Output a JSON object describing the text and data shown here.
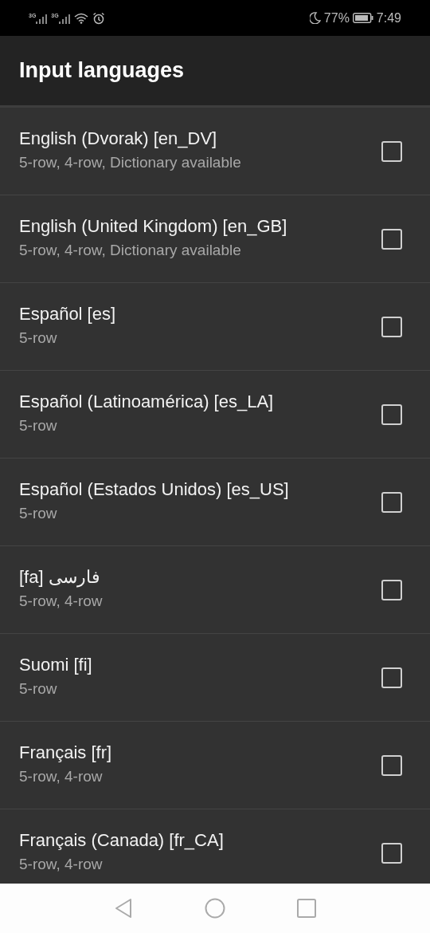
{
  "status_bar": {
    "network_labels": [
      "3G",
      "3G"
    ],
    "battery_percent": "77%",
    "time": "7:49"
  },
  "header": {
    "title": "Input languages"
  },
  "languages": [
    {
      "name": "English (Dvorak) [en_DV]",
      "layouts": "5-row, 4-row, Dictionary available",
      "checked": false
    },
    {
      "name": "English (United Kingdom) [en_GB]",
      "layouts": "5-row, 4-row, Dictionary available",
      "checked": false
    },
    {
      "name": "Español [es]",
      "layouts": "5-row",
      "checked": false
    },
    {
      "name": "Español (Latinoamérica) [es_LA]",
      "layouts": "5-row",
      "checked": false
    },
    {
      "name": "Español (Estados Unidos) [es_US]",
      "layouts": "5-row",
      "checked": false
    },
    {
      "name": "[fa] فارسی",
      "layouts": "5-row, 4-row",
      "checked": false
    },
    {
      "name": "Suomi [fi]",
      "layouts": "5-row",
      "checked": false
    },
    {
      "name": "Français [fr]",
      "layouts": "5-row, 4-row",
      "checked": false
    },
    {
      "name": "Français (Canada) [fr_CA]",
      "layouts": "5-row, 4-row",
      "checked": false
    }
  ]
}
